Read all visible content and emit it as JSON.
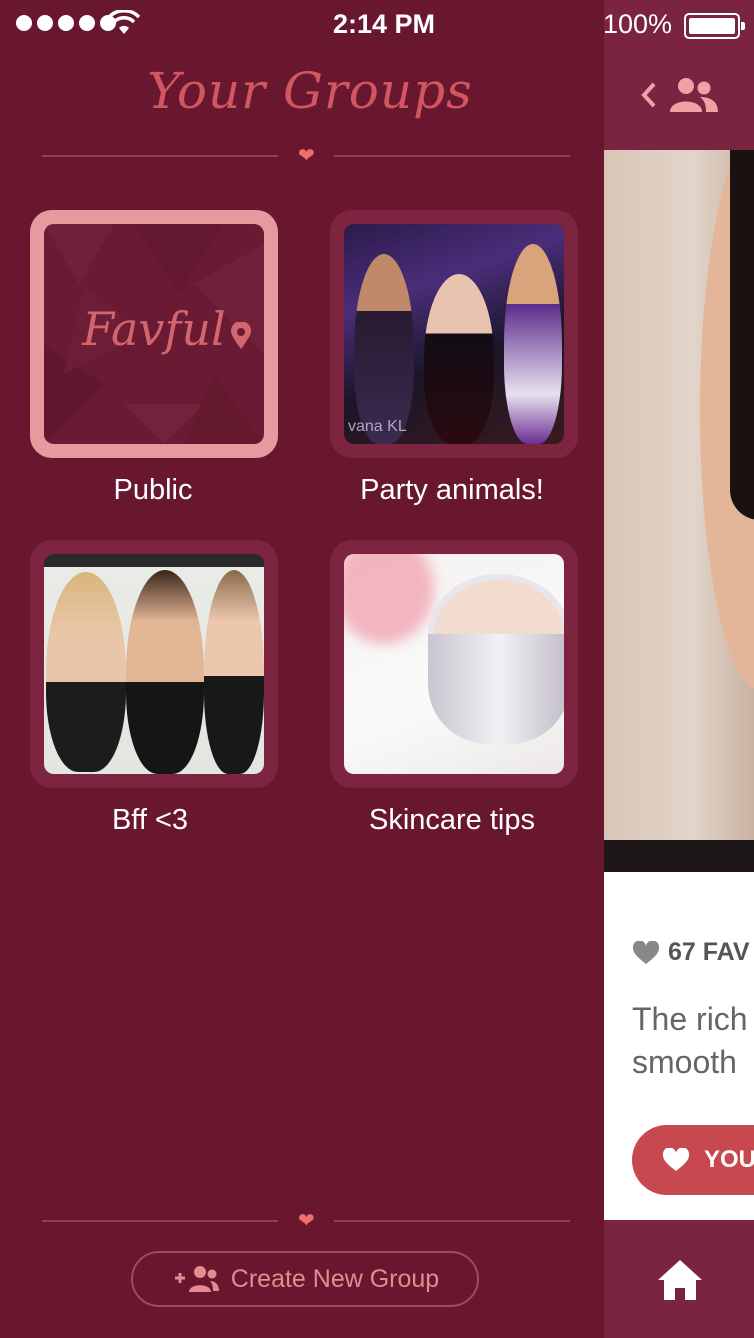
{
  "status_bar": {
    "time": "2:14 PM",
    "battery": "100%"
  },
  "drawer": {
    "title": "Your Groups",
    "groups": [
      {
        "label": "Public",
        "logo_text": "Favful"
      },
      {
        "label": "Party animals!",
        "caption": "vana KL"
      },
      {
        "label": "Bff <3"
      },
      {
        "label": "Skincare tips"
      }
    ],
    "create_button": "Create New Group"
  },
  "main": {
    "favs": "67 FAV",
    "description_line1": "The rich",
    "description_line2": "smooth",
    "fav_button": "YOU"
  },
  "colors": {
    "drawer_bg": "#69162f",
    "accent": "#d0565f",
    "heart": "#f06e6e",
    "selected_border": "#e59a9f"
  }
}
